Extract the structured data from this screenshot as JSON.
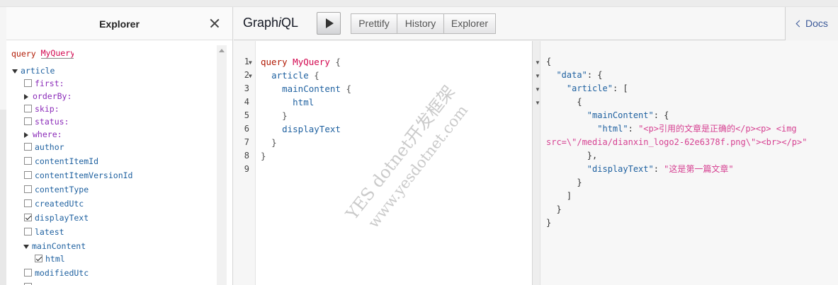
{
  "explorer": {
    "title": "Explorer",
    "query_keyword": "query",
    "query_name": "MyQuery",
    "root_field": "article",
    "fields": [
      {
        "label": "first:",
        "type": "arg",
        "checked": false
      },
      {
        "label": "orderBy:",
        "type": "arg-expand",
        "checked": false
      },
      {
        "label": "skip:",
        "type": "arg",
        "checked": false
      },
      {
        "label": "status:",
        "type": "arg",
        "checked": false
      },
      {
        "label": "where:",
        "type": "arg-expand",
        "checked": false
      },
      {
        "label": "author",
        "type": "field",
        "checked": false
      },
      {
        "label": "contentItemId",
        "type": "field",
        "checked": false
      },
      {
        "label": "contentItemVersionId",
        "type": "field",
        "checked": false
      },
      {
        "label": "contentType",
        "type": "field",
        "checked": false
      },
      {
        "label": "createdUtc",
        "type": "field",
        "checked": false
      },
      {
        "label": "displayText",
        "type": "field",
        "checked": true
      },
      {
        "label": "latest",
        "type": "field",
        "checked": false
      },
      {
        "label": "mainContent",
        "type": "expanded",
        "checked": false
      },
      {
        "label": "html",
        "type": "subfield",
        "checked": true
      },
      {
        "label": "modifiedUtc",
        "type": "field",
        "checked": false
      }
    ]
  },
  "toolbar": {
    "logo_pre": "Graph",
    "logo_i": "i",
    "logo_post": "QL",
    "prettify": "Prettify",
    "history": "History",
    "explorer": "Explorer",
    "docs": "Docs"
  },
  "editor": {
    "line_numbers": [
      "1",
      "2",
      "3",
      "4",
      "5",
      "6",
      "7",
      "8",
      "9"
    ],
    "query_keyword": "query",
    "query_name": "MyQuery",
    "brace_open": "{",
    "brace_close": "}",
    "field_article": "article",
    "field_mainContent": "mainContent",
    "field_html": "html",
    "field_displayText": "displayText"
  },
  "result": {
    "key_data": "\"data\"",
    "key_article": "\"article\"",
    "key_mainContent": "\"mainContent\"",
    "key_html": "\"html\"",
    "html_value_line1": "\"<p>引用的文章是正确的</p><p> <img",
    "html_value_line2": "src=\\\"/media/dianxin_logo2-62e6378f.png\\\"><br></p>\"",
    "key_displayText": "\"displayText\"",
    "displayText_value": "\"这是第一篇文章\""
  },
  "watermark": {
    "line1": "YES dotnet开发框架",
    "line2": "www.yesdotnet.com"
  }
}
